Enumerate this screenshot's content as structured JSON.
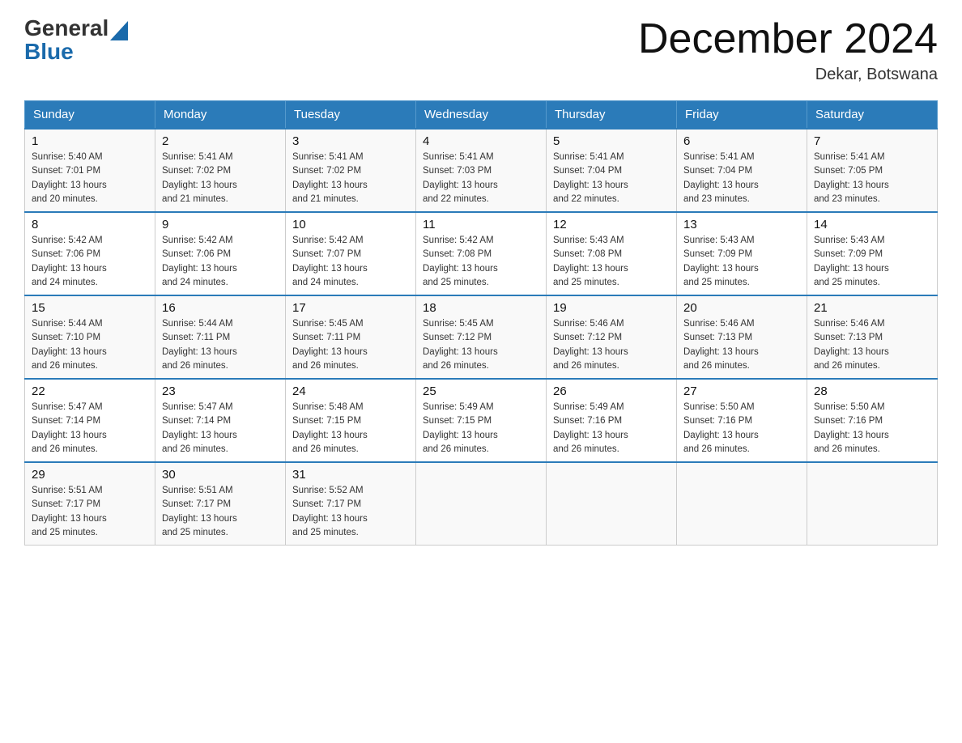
{
  "header": {
    "logo_general": "General",
    "logo_blue": "Blue",
    "month_title": "December 2024",
    "location": "Dekar, Botswana"
  },
  "days_of_week": [
    "Sunday",
    "Monday",
    "Tuesday",
    "Wednesday",
    "Thursday",
    "Friday",
    "Saturday"
  ],
  "weeks": [
    [
      {
        "day": "1",
        "sunrise": "5:40 AM",
        "sunset": "7:01 PM",
        "daylight": "13 hours and 20 minutes."
      },
      {
        "day": "2",
        "sunrise": "5:41 AM",
        "sunset": "7:02 PM",
        "daylight": "13 hours and 21 minutes."
      },
      {
        "day": "3",
        "sunrise": "5:41 AM",
        "sunset": "7:02 PM",
        "daylight": "13 hours and 21 minutes."
      },
      {
        "day": "4",
        "sunrise": "5:41 AM",
        "sunset": "7:03 PM",
        "daylight": "13 hours and 22 minutes."
      },
      {
        "day": "5",
        "sunrise": "5:41 AM",
        "sunset": "7:04 PM",
        "daylight": "13 hours and 22 minutes."
      },
      {
        "day": "6",
        "sunrise": "5:41 AM",
        "sunset": "7:04 PM",
        "daylight": "13 hours and 23 minutes."
      },
      {
        "day": "7",
        "sunrise": "5:41 AM",
        "sunset": "7:05 PM",
        "daylight": "13 hours and 23 minutes."
      }
    ],
    [
      {
        "day": "8",
        "sunrise": "5:42 AM",
        "sunset": "7:06 PM",
        "daylight": "13 hours and 24 minutes."
      },
      {
        "day": "9",
        "sunrise": "5:42 AM",
        "sunset": "7:06 PM",
        "daylight": "13 hours and 24 minutes."
      },
      {
        "day": "10",
        "sunrise": "5:42 AM",
        "sunset": "7:07 PM",
        "daylight": "13 hours and 24 minutes."
      },
      {
        "day": "11",
        "sunrise": "5:42 AM",
        "sunset": "7:08 PM",
        "daylight": "13 hours and 25 minutes."
      },
      {
        "day": "12",
        "sunrise": "5:43 AM",
        "sunset": "7:08 PM",
        "daylight": "13 hours and 25 minutes."
      },
      {
        "day": "13",
        "sunrise": "5:43 AM",
        "sunset": "7:09 PM",
        "daylight": "13 hours and 25 minutes."
      },
      {
        "day": "14",
        "sunrise": "5:43 AM",
        "sunset": "7:09 PM",
        "daylight": "13 hours and 25 minutes."
      }
    ],
    [
      {
        "day": "15",
        "sunrise": "5:44 AM",
        "sunset": "7:10 PM",
        "daylight": "13 hours and 26 minutes."
      },
      {
        "day": "16",
        "sunrise": "5:44 AM",
        "sunset": "7:11 PM",
        "daylight": "13 hours and 26 minutes."
      },
      {
        "day": "17",
        "sunrise": "5:45 AM",
        "sunset": "7:11 PM",
        "daylight": "13 hours and 26 minutes."
      },
      {
        "day": "18",
        "sunrise": "5:45 AM",
        "sunset": "7:12 PM",
        "daylight": "13 hours and 26 minutes."
      },
      {
        "day": "19",
        "sunrise": "5:46 AM",
        "sunset": "7:12 PM",
        "daylight": "13 hours and 26 minutes."
      },
      {
        "day": "20",
        "sunrise": "5:46 AM",
        "sunset": "7:13 PM",
        "daylight": "13 hours and 26 minutes."
      },
      {
        "day": "21",
        "sunrise": "5:46 AM",
        "sunset": "7:13 PM",
        "daylight": "13 hours and 26 minutes."
      }
    ],
    [
      {
        "day": "22",
        "sunrise": "5:47 AM",
        "sunset": "7:14 PM",
        "daylight": "13 hours and 26 minutes."
      },
      {
        "day": "23",
        "sunrise": "5:47 AM",
        "sunset": "7:14 PM",
        "daylight": "13 hours and 26 minutes."
      },
      {
        "day": "24",
        "sunrise": "5:48 AM",
        "sunset": "7:15 PM",
        "daylight": "13 hours and 26 minutes."
      },
      {
        "day": "25",
        "sunrise": "5:49 AM",
        "sunset": "7:15 PM",
        "daylight": "13 hours and 26 minutes."
      },
      {
        "day": "26",
        "sunrise": "5:49 AM",
        "sunset": "7:16 PM",
        "daylight": "13 hours and 26 minutes."
      },
      {
        "day": "27",
        "sunrise": "5:50 AM",
        "sunset": "7:16 PM",
        "daylight": "13 hours and 26 minutes."
      },
      {
        "day": "28",
        "sunrise": "5:50 AM",
        "sunset": "7:16 PM",
        "daylight": "13 hours and 26 minutes."
      }
    ],
    [
      {
        "day": "29",
        "sunrise": "5:51 AM",
        "sunset": "7:17 PM",
        "daylight": "13 hours and 25 minutes."
      },
      {
        "day": "30",
        "sunrise": "5:51 AM",
        "sunset": "7:17 PM",
        "daylight": "13 hours and 25 minutes."
      },
      {
        "day": "31",
        "sunrise": "5:52 AM",
        "sunset": "7:17 PM",
        "daylight": "13 hours and 25 minutes."
      },
      null,
      null,
      null,
      null
    ]
  ]
}
